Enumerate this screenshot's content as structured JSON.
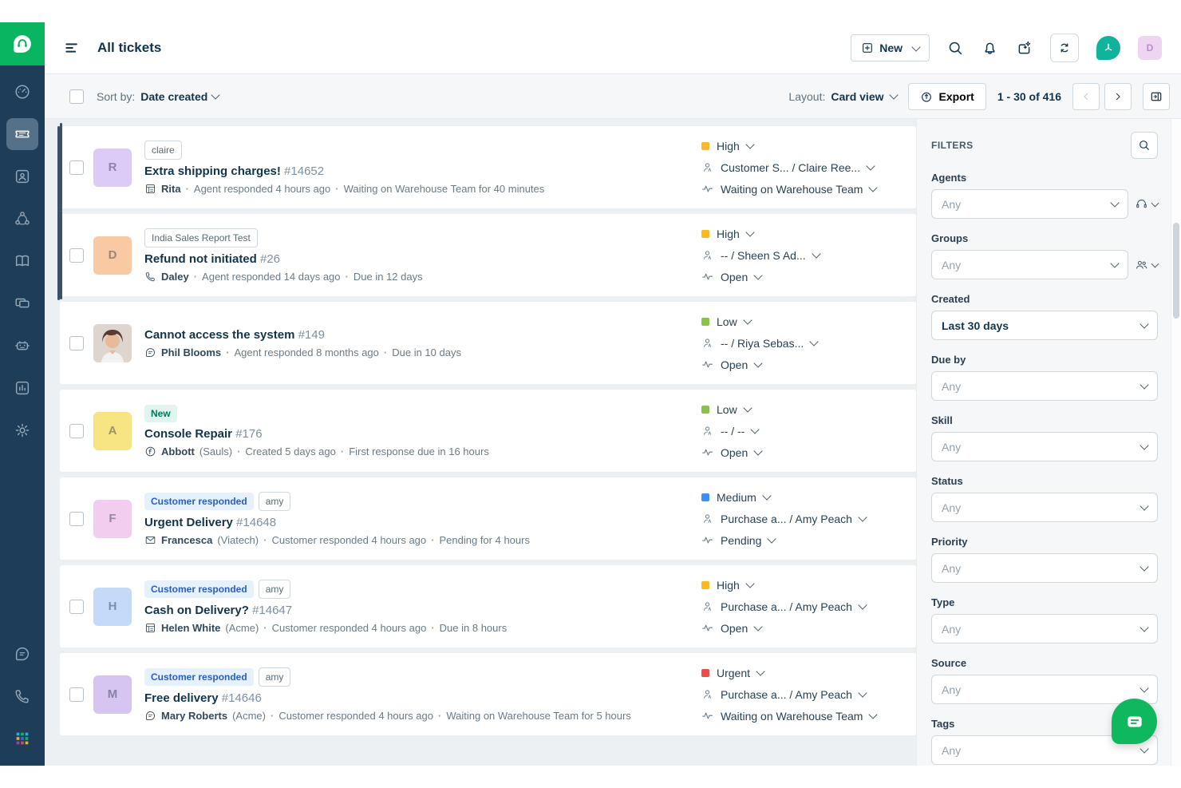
{
  "header": {
    "title": "All tickets",
    "new_button": "New",
    "user_initial": "D"
  },
  "toolbar": {
    "sort_label": "Sort by:",
    "sort_value": "Date created",
    "layout_label": "Layout:",
    "layout_value": "Card view",
    "export_label": "Export",
    "pagination": "1 - 30 of 416"
  },
  "sidebar": {
    "items": [
      "logo",
      "dashboard",
      "tickets",
      "contacts",
      "social",
      "knowledge-base",
      "forums",
      "bots",
      "analytics",
      "admin",
      "feedback",
      "phone",
      "apps"
    ],
    "active_item": "tickets",
    "bg_color": "#1e3d59",
    "accent_color": "#0ab561"
  },
  "tickets": [
    {
      "avatar": {
        "text": "R",
        "bg": "#ddcbf7",
        "photo": false
      },
      "badges": [
        {
          "label": "claire",
          "type": "tag"
        }
      ],
      "title": "Extra shipping charges!",
      "id": "#14652",
      "source_icon": "form-icon",
      "requester": "Rita",
      "company": "",
      "meta_items": [
        "Agent responded 4 hours ago",
        "Waiting on Warehouse Team for 40 minutes"
      ],
      "priority": {
        "label": "High",
        "color": "#fdb924"
      },
      "assignee": "Customer S... / Claire Ree...",
      "status": "Waiting on Warehouse Team",
      "unread": true
    },
    {
      "avatar": {
        "text": "D",
        "bg": "#f9c9a4",
        "photo": false
      },
      "badges": [
        {
          "label": "India Sales Report Test",
          "type": "tag"
        }
      ],
      "title": "Refund not initiated",
      "id": "#26",
      "source_icon": "phone-icon",
      "requester": "Daley",
      "company": "",
      "meta_items": [
        "Agent responded 14 days ago",
        "Due in 12 days"
      ],
      "priority": {
        "label": "High",
        "color": "#fdb924"
      },
      "assignee": "-- / Sheen S Ad...",
      "status": "Open",
      "unread": true
    },
    {
      "avatar": {
        "text": "",
        "bg": "#e8ddd6",
        "photo": true
      },
      "badges": [],
      "title": "Cannot access the system",
      "id": "#149",
      "source_icon": "feedback-icon",
      "requester": "Phil Blooms",
      "company": "",
      "meta_items": [
        "Agent responded 8 months ago",
        "Due in 10 days"
      ],
      "priority": {
        "label": "Low",
        "color": "#8bc34a"
      },
      "assignee": "-- / Riya Sebas...",
      "status": "Open",
      "unread": false
    },
    {
      "avatar": {
        "text": "A",
        "bg": "#f7e483",
        "photo": false
      },
      "badges": [
        {
          "label": "New",
          "type": "new"
        }
      ],
      "title": "Console Repair",
      "id": "#176",
      "source_icon": "facebook-icon",
      "requester": "Abbott",
      "company": "Sauls",
      "meta_items": [
        "Created 5 days ago",
        "First response due in 16 hours"
      ],
      "priority": {
        "label": "Low",
        "color": "#8bc34a"
      },
      "assignee": "-- / --",
      "status": "Open",
      "unread": false
    },
    {
      "avatar": {
        "text": "F",
        "bg": "#f2cdf0",
        "photo": false
      },
      "badges": [
        {
          "label": "Customer responded",
          "type": "responded"
        },
        {
          "label": "amy",
          "type": "tag"
        }
      ],
      "title": "Urgent Delivery",
      "id": "#14648",
      "source_icon": "email-icon",
      "requester": "Francesca",
      "company": "Viatech",
      "meta_items": [
        "Customer responded 4 hours ago",
        "Pending for 4 hours"
      ],
      "priority": {
        "label": "Medium",
        "color": "#3e8ef7"
      },
      "assignee": "Purchase a... / Amy Peach",
      "status": "Pending",
      "unread": false
    },
    {
      "avatar": {
        "text": "H",
        "bg": "#c5d9f9",
        "photo": false
      },
      "badges": [
        {
          "label": "Customer responded",
          "type": "responded"
        },
        {
          "label": "amy",
          "type": "tag"
        }
      ],
      "title": "Cash on Delivery?",
      "id": "#14647",
      "source_icon": "form-icon",
      "requester": "Helen White",
      "company": "Acme",
      "meta_items": [
        "Customer responded 4 hours ago",
        "Due in 8 hours"
      ],
      "priority": {
        "label": "High",
        "color": "#fdb924"
      },
      "assignee": "Purchase a... / Amy Peach",
      "status": "Open",
      "unread": false
    },
    {
      "avatar": {
        "text": "M",
        "bg": "#d5c5f0",
        "photo": false
      },
      "badges": [
        {
          "label": "Customer responded",
          "type": "responded"
        },
        {
          "label": "amy",
          "type": "tag"
        }
      ],
      "title": "Free delivery",
      "id": "#14646",
      "source_icon": "feedback-icon",
      "requester": "Mary Roberts",
      "company": "Acme",
      "meta_items": [
        "Customer responded 4 hours ago",
        "Waiting on Warehouse Team for 5 hours"
      ],
      "priority": {
        "label": "Urgent",
        "color": "#ee4b4b"
      },
      "assignee": "Purchase a... / Amy Peach",
      "status": "Waiting on Warehouse Team",
      "unread": false
    }
  ],
  "filters": {
    "heading": "FILTERS",
    "groups": [
      {
        "label": "Agents",
        "value": "Any",
        "placeholder": true,
        "side_icon": "headset-icon"
      },
      {
        "label": "Groups",
        "value": "Any",
        "placeholder": true,
        "side_icon": "people-icon"
      },
      {
        "label": "Created",
        "value": "Last 30 days",
        "placeholder": false,
        "side_icon": ""
      },
      {
        "label": "Due by",
        "value": "Any",
        "placeholder": true,
        "side_icon": ""
      },
      {
        "label": "Skill",
        "value": "Any",
        "placeholder": true,
        "side_icon": ""
      },
      {
        "label": "Status",
        "value": "Any",
        "placeholder": true,
        "side_icon": ""
      },
      {
        "label": "Priority",
        "value": "Any",
        "placeholder": true,
        "side_icon": ""
      },
      {
        "label": "Type",
        "value": "Any",
        "placeholder": true,
        "side_icon": ""
      },
      {
        "label": "Source",
        "value": "Any",
        "placeholder": true,
        "side_icon": ""
      },
      {
        "label": "Tags",
        "value": "Any",
        "placeholder": true,
        "side_icon": ""
      }
    ]
  },
  "colors": {
    "priority_high": "#fdb924",
    "priority_medium": "#3e8ef7",
    "priority_low": "#8bc34a",
    "priority_urgent": "#ee4b4b",
    "fab_green": "#0fb85f",
    "brand_teal": "#12b39c"
  }
}
